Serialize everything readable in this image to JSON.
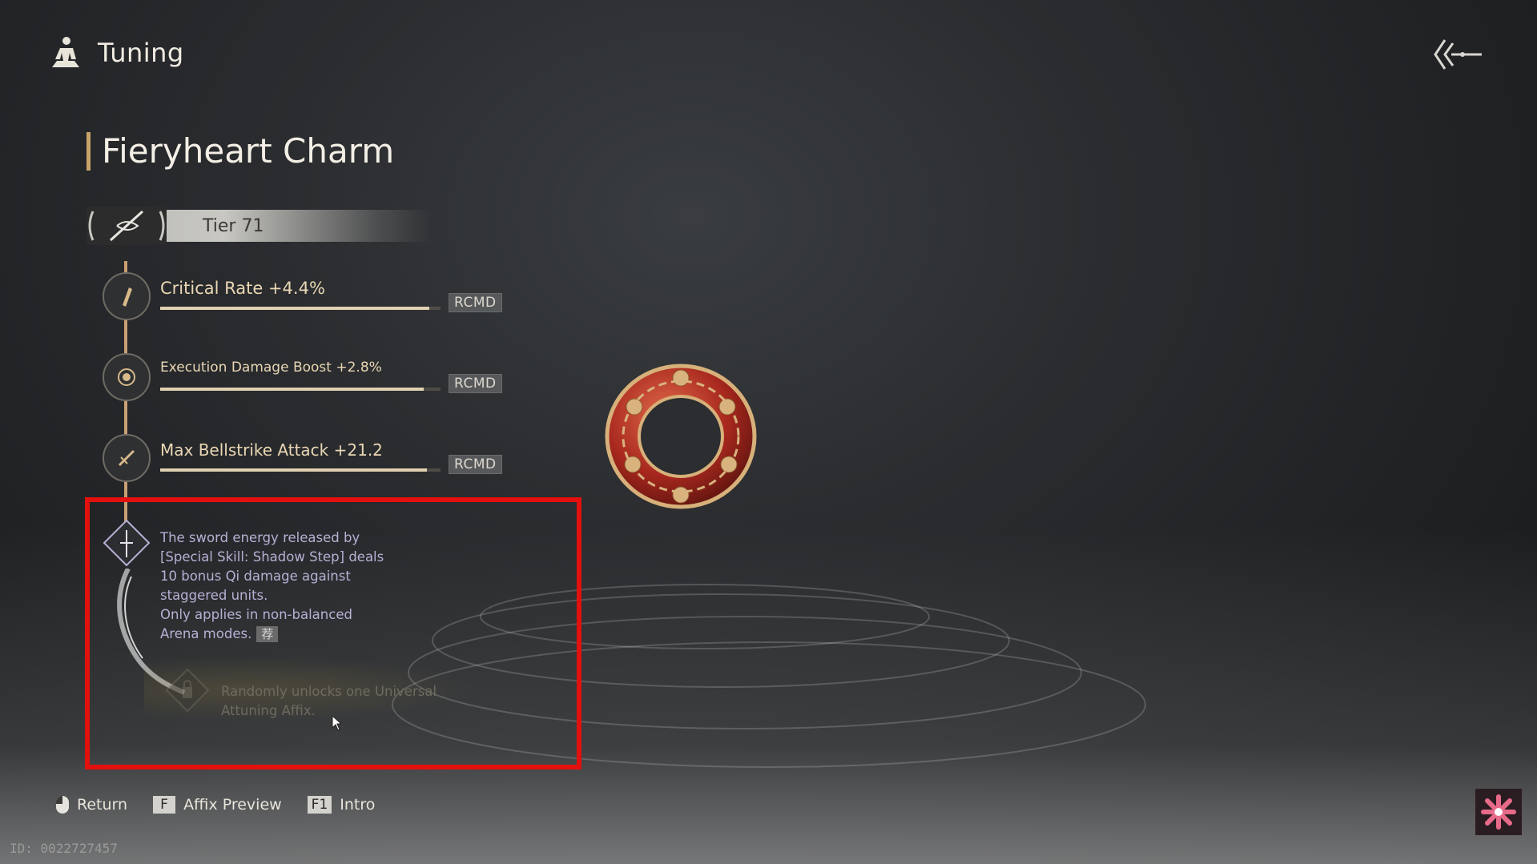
{
  "header": {
    "title": "Tuning",
    "icon": "meditation-icon"
  },
  "back": {
    "icon": "back-arrow-icon"
  },
  "item": {
    "name": "Fieryheart Charm",
    "tier_label": "Tier 71"
  },
  "affixes": [
    {
      "text": "Critical Rate +4.4%",
      "progress": 0.96,
      "badge": "RCMD",
      "icon": "scroll-icon"
    },
    {
      "text": "Execution Damage Boost +2.8%",
      "progress": 0.94,
      "badge": "RCMD",
      "icon": "emblem-icon"
    },
    {
      "text": "Max Bellstrike Attack +21.2",
      "progress": 0.95,
      "badge": "RCMD",
      "icon": "sword-icon"
    }
  ],
  "special": {
    "lines": [
      "The sword energy released by",
      "[Special Skill: Shadow Step] deals",
      "10 bonus Qi damage against",
      "staggered units.",
      "Only applies in non-balanced",
      "Arena modes."
    ],
    "badge": "荐",
    "icon": "diamond-sword-icon"
  },
  "locked": {
    "lines": [
      "Randomly unlocks one Universal",
      "Attuning Affix."
    ],
    "icon": "locked-affix-icon"
  },
  "hints": {
    "return_label": "Return",
    "affix_key": "F",
    "affix_label": "Affix Preview",
    "intro_key": "F1",
    "intro_label": "Intro"
  },
  "uid": "ID: 0022727457",
  "colors": {
    "accent": "#c9a36a",
    "highlight": "#e3100e",
    "special_text": "#b7b0d4"
  }
}
